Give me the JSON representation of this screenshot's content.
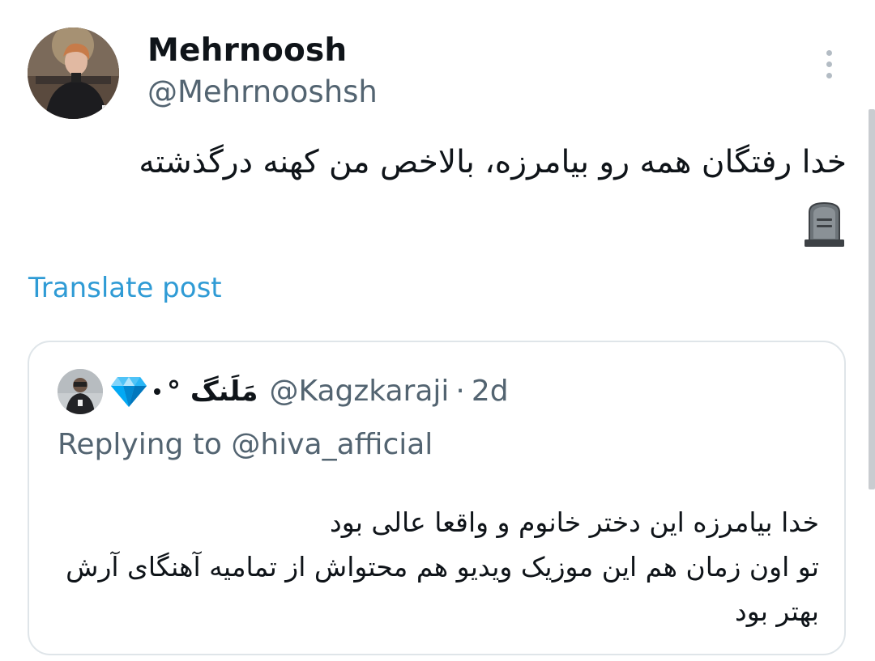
{
  "author": {
    "display_name": "Mehrnoosh",
    "handle": "@Mehrnooshsh",
    "avatar_icon": "profile-photo"
  },
  "more_icon": "more-vertical-icon",
  "tweet": {
    "text": "خدا رفتگان همه رو بیامرزه، بالاخص من کهنه درگذشته",
    "emoji_icon": "headstone-icon"
  },
  "translate_label": "Translate post",
  "quoted": {
    "display_name": "مَلَنگ °",
    "badge_icon": "gem-stone-icon",
    "handle": "@Kagzkaraji",
    "separator": "·",
    "time": "2d",
    "replying_to": "Replying to @hiva_afficial",
    "text_lines": [
      "خدا بیامرزه این دختر خانوم و واقعا عالی بود",
      "تو اون زمان هم این موزیک ویدیو هم محتواش از تمامیه آهنگای آرش بهتر بود"
    ]
  },
  "colors": {
    "text_primary": "#0f1419",
    "text_secondary": "#536471",
    "link": "#2f9bd5",
    "card_border": "#dfe5e9"
  }
}
